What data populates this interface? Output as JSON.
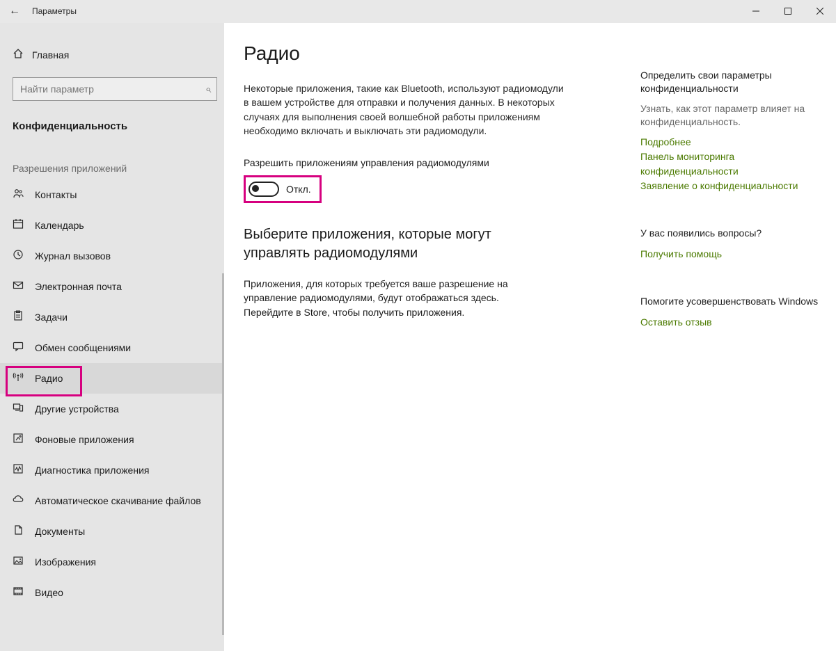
{
  "titlebar": {
    "title": "Параметры"
  },
  "sidebar": {
    "home_label": "Главная",
    "search_placeholder": "Найти параметр",
    "section_title": "Конфиденциальность",
    "group_label": "Разрешения приложений",
    "items": [
      {
        "icon": "contacts",
        "label": "Контакты"
      },
      {
        "icon": "calendar",
        "label": "Календарь"
      },
      {
        "icon": "history",
        "label": "Журнал вызовов"
      },
      {
        "icon": "mail",
        "label": "Электронная почта"
      },
      {
        "icon": "tasks",
        "label": "Задачи"
      },
      {
        "icon": "messaging",
        "label": "Обмен сообщениями"
      },
      {
        "icon": "radio",
        "label": "Радио",
        "active": true
      },
      {
        "icon": "devices",
        "label": "Другие устройства"
      },
      {
        "icon": "background",
        "label": "Фоновые приложения"
      },
      {
        "icon": "diagnostics",
        "label": "Диагностика приложения"
      },
      {
        "icon": "download",
        "label": "Автоматическое скачивание файлов"
      },
      {
        "icon": "documents",
        "label": "Документы"
      },
      {
        "icon": "pictures",
        "label": "Изображения"
      },
      {
        "icon": "video",
        "label": "Видео"
      }
    ]
  },
  "main": {
    "page_title": "Радио",
    "intro": "Некоторые приложения, такие как Bluetooth, используют радиомодули в вашем устройстве для отправки и получения данных. В некоторых случаях для выполнения своей волшебной работы приложениям необходимо включать и выключать эти радиомодули.",
    "toggle_label": "Разрешить приложениям управления радиомодулями",
    "toggle_state": "Откл.",
    "sub_title": "Выберите приложения, которые могут управлять радиомодулями",
    "sub_text": "Приложения, для которых требуется ваше разрешение на управление радиомодулями, будут отображаться здесь. Перейдите в Store, чтобы получить приложения."
  },
  "info": {
    "privacy_head": "Определить свои параметры конфиденциальности",
    "privacy_desc": "Узнать, как этот параметр влияет на конфиденциальность.",
    "link_more": "Подробнее",
    "link_dashboard": "Панель мониторинга конфиденциальности",
    "link_statement": "Заявление о конфиденциальности",
    "help_head": "У вас появились вопросы?",
    "link_help": "Получить помощь",
    "feedback_head": "Помогите усовершенствовать Windows",
    "link_feedback": "Оставить отзыв"
  },
  "colors": {
    "highlight": "#d6007f",
    "link": "#4b7a00"
  }
}
